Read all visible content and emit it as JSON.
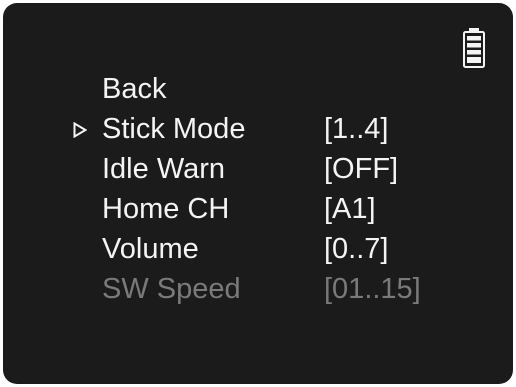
{
  "status": {
    "battery_icon": "battery-full-icon"
  },
  "menu": {
    "selected_index": 1,
    "items": [
      {
        "label": "Back",
        "value": "",
        "enabled": true
      },
      {
        "label": "Stick Mode",
        "value": "[1..4]",
        "enabled": true
      },
      {
        "label": "Idle Warn",
        "value": "[OFF]",
        "enabled": true
      },
      {
        "label": "Home CH",
        "value": "[A1]",
        "enabled": true
      },
      {
        "label": "Volume",
        "value": "[0..7]",
        "enabled": true
      },
      {
        "label": "SW Speed",
        "value": "[01..15]",
        "enabled": false
      }
    ]
  },
  "colors": {
    "screen_background": "#1b1b1b",
    "text": "#f4f4f4",
    "disabled_text": "#7a7a7a"
  }
}
